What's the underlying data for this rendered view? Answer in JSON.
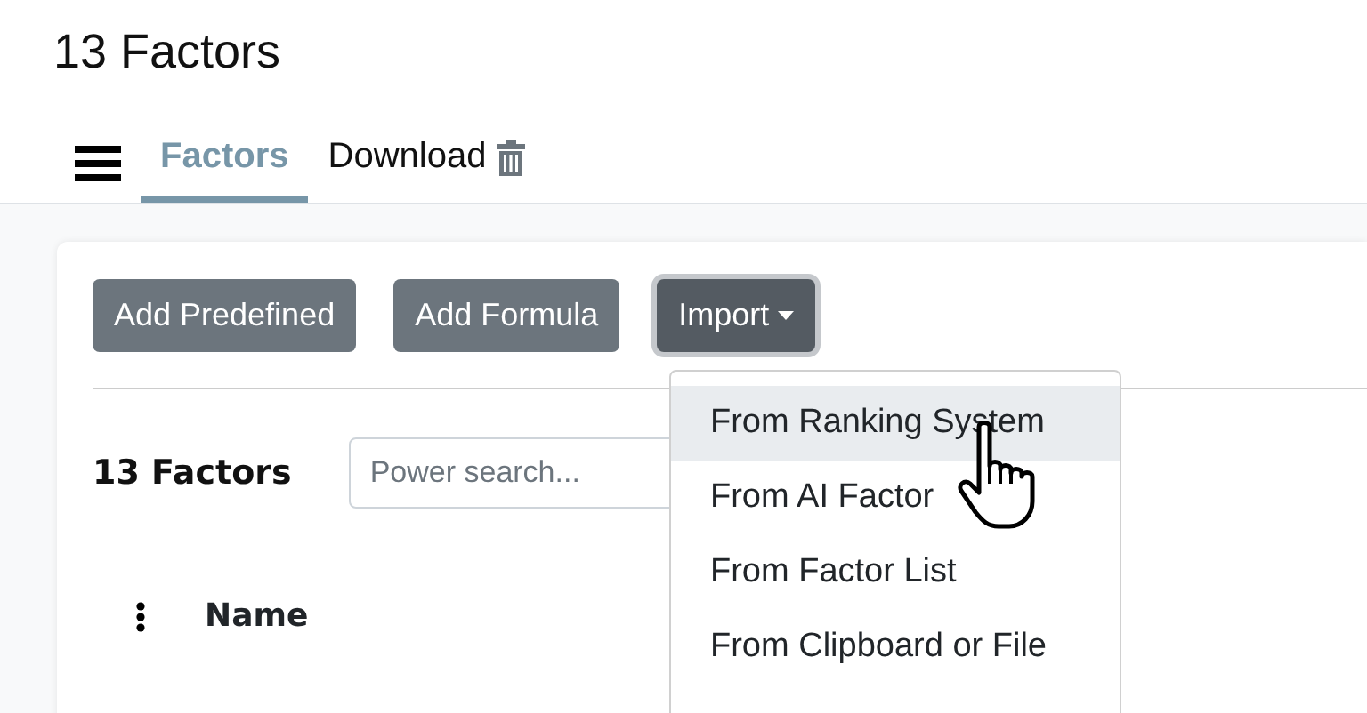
{
  "page_title": "13 Factors",
  "tabs": [
    {
      "label": "Factors",
      "selected": true
    },
    {
      "label": "Download",
      "selected": false
    }
  ],
  "toolbar": {
    "buttons": [
      {
        "label": "Add Predefined",
        "kind": "plain",
        "focused": false
      },
      {
        "label": "Add Formula",
        "kind": "plain",
        "focused": false
      },
      {
        "label": "Import",
        "kind": "dropdown",
        "focused": true
      }
    ]
  },
  "import_menu": {
    "items": [
      {
        "label": "From Ranking System",
        "selected": true
      },
      {
        "label": "From AI Factor",
        "selected": false
      },
      {
        "label": "From Factor List",
        "selected": false
      },
      {
        "label": "From Clipboard or File",
        "selected": false
      }
    ]
  },
  "list": {
    "heading": "13 Factors",
    "search": {
      "placeholder": "Power search..."
    },
    "columns": [
      "Name"
    ]
  }
}
